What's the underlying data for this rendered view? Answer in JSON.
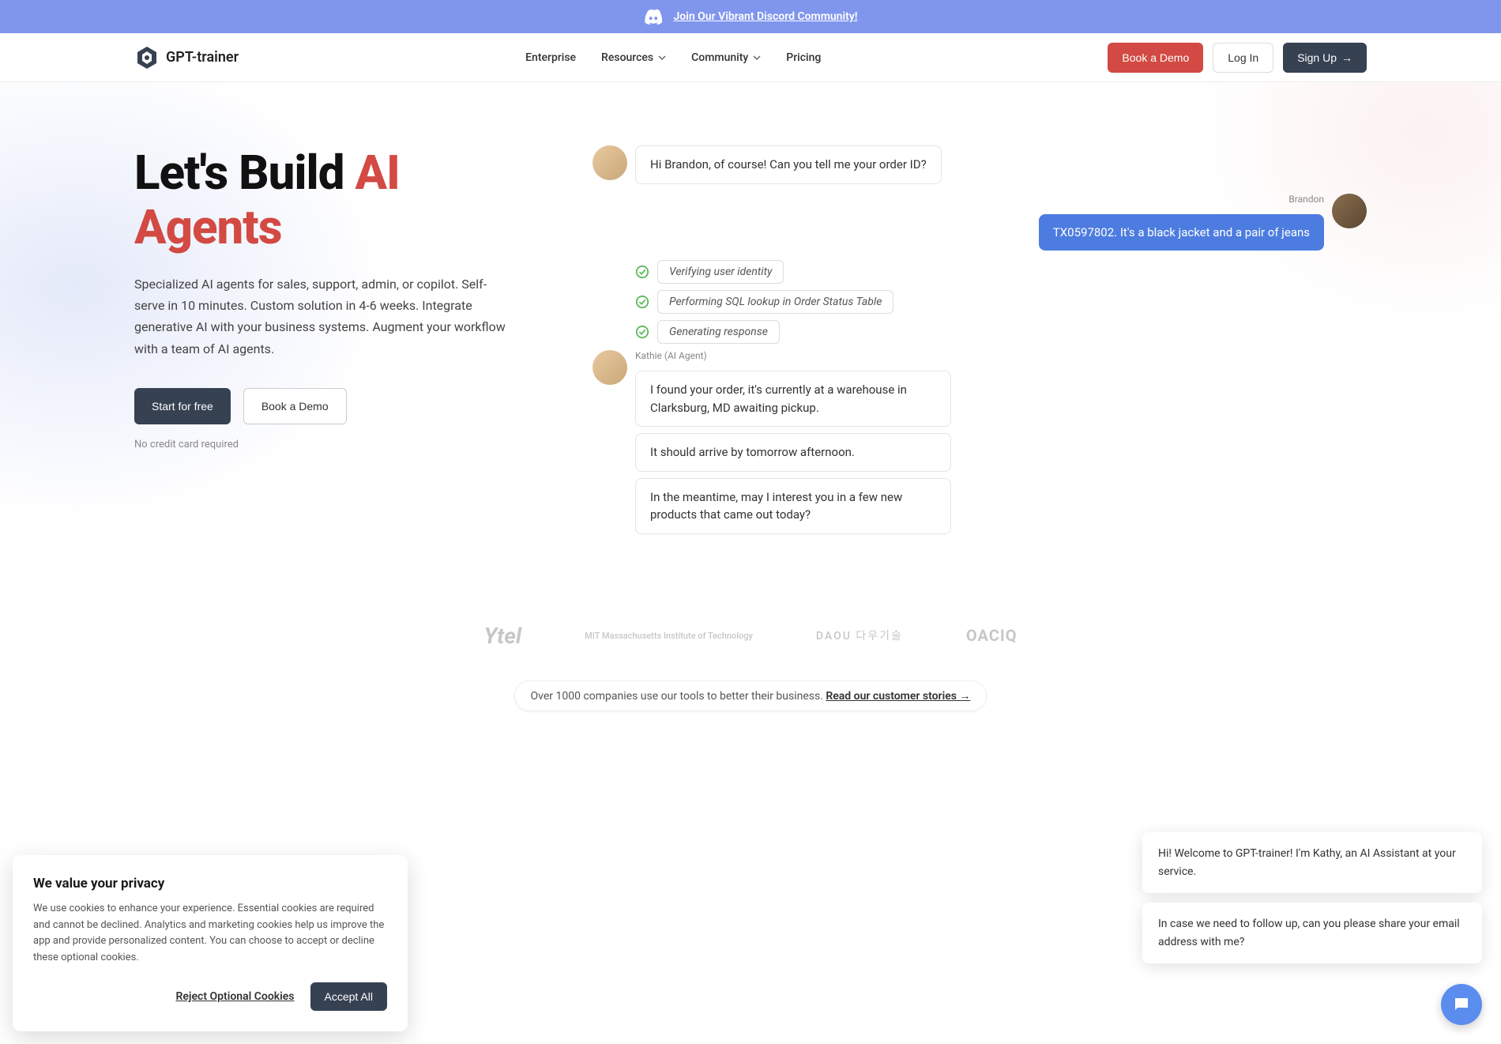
{
  "banner": {
    "link_text": "Join Our Vibrant Discord Community!"
  },
  "header": {
    "brand": "GPT-trainer",
    "nav": {
      "enterprise": "Enterprise",
      "resources": "Resources",
      "community": "Community",
      "pricing": "Pricing"
    },
    "actions": {
      "demo": "Book a Demo",
      "login": "Log In",
      "signup": "Sign Up"
    }
  },
  "hero": {
    "title_prefix": "Let's Build ",
    "title_accent": "AI Agents",
    "description": "Specialized AI agents for sales, support, admin, or copilot. Self-serve in 10 minutes. Custom solution in 4-6 weeks. Integrate generative AI with your business systems. Augment your workflow with a team of AI agents.",
    "cta_start": "Start for free",
    "cta_demo": "Book a Demo",
    "note": "No credit card required"
  },
  "chat": {
    "ai_name": "Kathie (AI Agent)",
    "user_name": "Brandon",
    "msg1": "Hi Brandon, of course! Can you tell me your order ID?",
    "msg2": "TX0597802. It's a black jacket and a pair of jeans",
    "status1": "Verifying user identity",
    "status2": "Performing SQL lookup in Order Status Table",
    "status3": "Generating response",
    "msg3": "I found your order, it's currently at a warehouse in Clarksburg, MD awaiting pickup.",
    "msg4": "It should arrive by tomorrow afternoon.",
    "msg5": "In the meantime, may I interest you in a few new products that came out today?"
  },
  "logos": {
    "l1": "Ytel",
    "l2": "MIT Massachusetts Institute of Technology",
    "l3": "DAOU 다우기술",
    "l4": "OACIQ"
  },
  "companies": {
    "text": "Over 1000 companies use our tools to better their business. ",
    "link": "Read our customer stories →"
  },
  "cookie": {
    "title": "We value your privacy",
    "text": "We use cookies to enhance your experience. Essential cookies are required and cannot be declined. Analytics and marketing cookies help us improve the app and provide personalized content. You can choose to accept or decline these optional cookies.",
    "reject": "Reject Optional Cookies",
    "accept": "Accept All"
  },
  "widget": {
    "msg1": "Hi! Welcome to GPT-trainer! I'm Kathy, an AI Assistant at your service.",
    "msg2": "In case we need to follow up, can you please share your email address with me?"
  }
}
